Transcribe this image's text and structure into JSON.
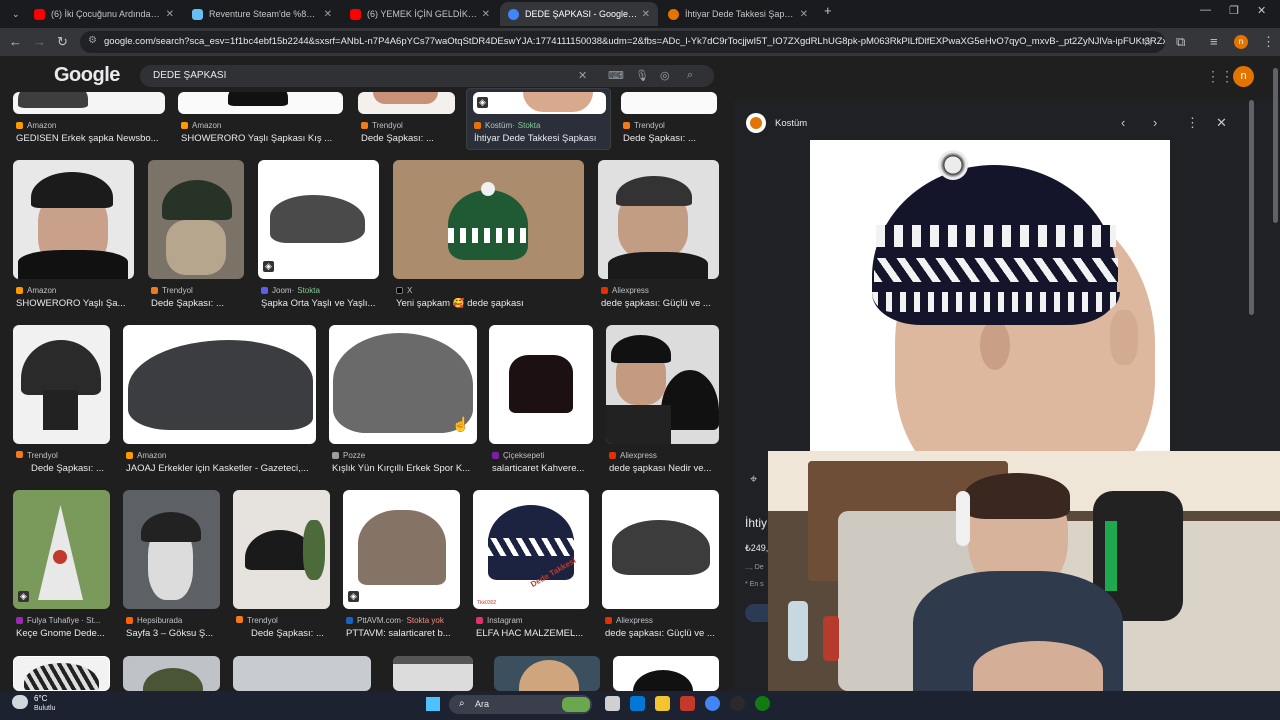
{
  "browser": {
    "tabs": [
      {
        "title": "(6) İki Çocuğunu Ardında Bırakı",
        "favicon_color": "#ff0000"
      },
      {
        "title": "Reventure Steam'de %83 İndirim",
        "favicon_color": "#1b2838"
      },
      {
        "title": "(6) YEMEK İÇİN GELDİK, EVE ALI",
        "favicon_color": "#ff0000"
      },
      {
        "title": "DEDE ŞAPKASI - Google'da Ara",
        "favicon_color": "#4285f4"
      },
      {
        "title": "İhtiyar Dede Takkesi Şapkası",
        "favicon_color": "#e37400"
      }
    ],
    "new_tab_icon": "+",
    "url": "google.com/search?sca_esv=1f1bc4ebf15b2244&sxsrf=ANbL-n7P4A6pYCs77waOtqStDR4DEswYJA:1774111150038&udm=2&fbs=ADc_l-Yk7dC9rTocjjwI5T_IO7ZXgdRLhUG8pk-pM063RkPlLfDlfEXPwaXG5eHvO7qyO_mxvB-_pt2ZyNJlVa-ipFUKt3RZxjPy..."
  },
  "google": {
    "logo": "Google",
    "query": "DEDE ŞAPKASI",
    "avatar_letter": "n"
  },
  "top_row": [
    {
      "source": "Amazon",
      "title": "GEDISEN Erkek şapka Newsbo..."
    },
    {
      "source": "Amazon",
      "title": "SHOWERORO Yaşlı Şapkası Kış ..."
    },
    {
      "source": "Trendyol",
      "title": "Dede Şapkası: ..."
    },
    {
      "source": "Kostüm",
      "stock": "Stokta",
      "title": "İhtiyar Dede Takkesi Şapkası"
    },
    {
      "source": "Trendyol",
      "title": "Dede Şapkası: ..."
    }
  ],
  "row1": [
    {
      "source": "Amazon",
      "title": "SHOWERORO Yaşlı Şa..."
    },
    {
      "source": "Trendyol",
      "title": "Dede Şapkası: ..."
    },
    {
      "source": "Joom",
      "stock": "Stokta",
      "title": "Şapka Orta Yaşlı ve Yaşlı..."
    },
    {
      "source": "X",
      "title": "Yeni şapkam 🥰 dede şapkası"
    },
    {
      "source": "Aliexpress",
      "title": "dede şapkası: Güçlü ve ..."
    }
  ],
  "row2": [
    {
      "source": "Trendyol",
      "title": "Dede Şapkası: ..."
    },
    {
      "source": "Amazon",
      "title": "JAOAJ Erkekler için Kasketler - Gazeteci,..."
    },
    {
      "source": "Pozze",
      "title": "Kışlık Yün Kırçıllı Erkek Spor K..."
    },
    {
      "source": "Çiçeksepeti",
      "title": "salarticaret Kahvere..."
    },
    {
      "source": "Aliexpress",
      "title": "dede şapkası Nedir ve..."
    }
  ],
  "row3": [
    {
      "source": "Fulya Tuhafiye · St...",
      "title": "Keçe Gnome Dede..."
    },
    {
      "source": "Hepsiburada",
      "title": "Sayfa 3 – Göksu Ş..."
    },
    {
      "source": "Trendyol",
      "title": "Dede Şapkası: ..."
    },
    {
      "source": "PttAVM.com",
      "nostock": "Stokta yok",
      "title": "PTTAVM: salarticaret b..."
    },
    {
      "source": "Instagram",
      "title": "ELFA HAC MALZEMEL..."
    },
    {
      "source": "Aliexpress",
      "title": "dede şapkası: Güçlü ve ..."
    }
  ],
  "image_text": {
    "dede_takkesi": "Dede Takkesi",
    "code": "Tkk0302"
  },
  "panel": {
    "source": "Kostüm",
    "title": "İhtiy",
    "price": "₺249,",
    "small1": "..., De",
    "small2": "* En s"
  },
  "taskbar": {
    "temperature": "6°C",
    "weather": "Bulutlu",
    "search_label": "Ara"
  }
}
